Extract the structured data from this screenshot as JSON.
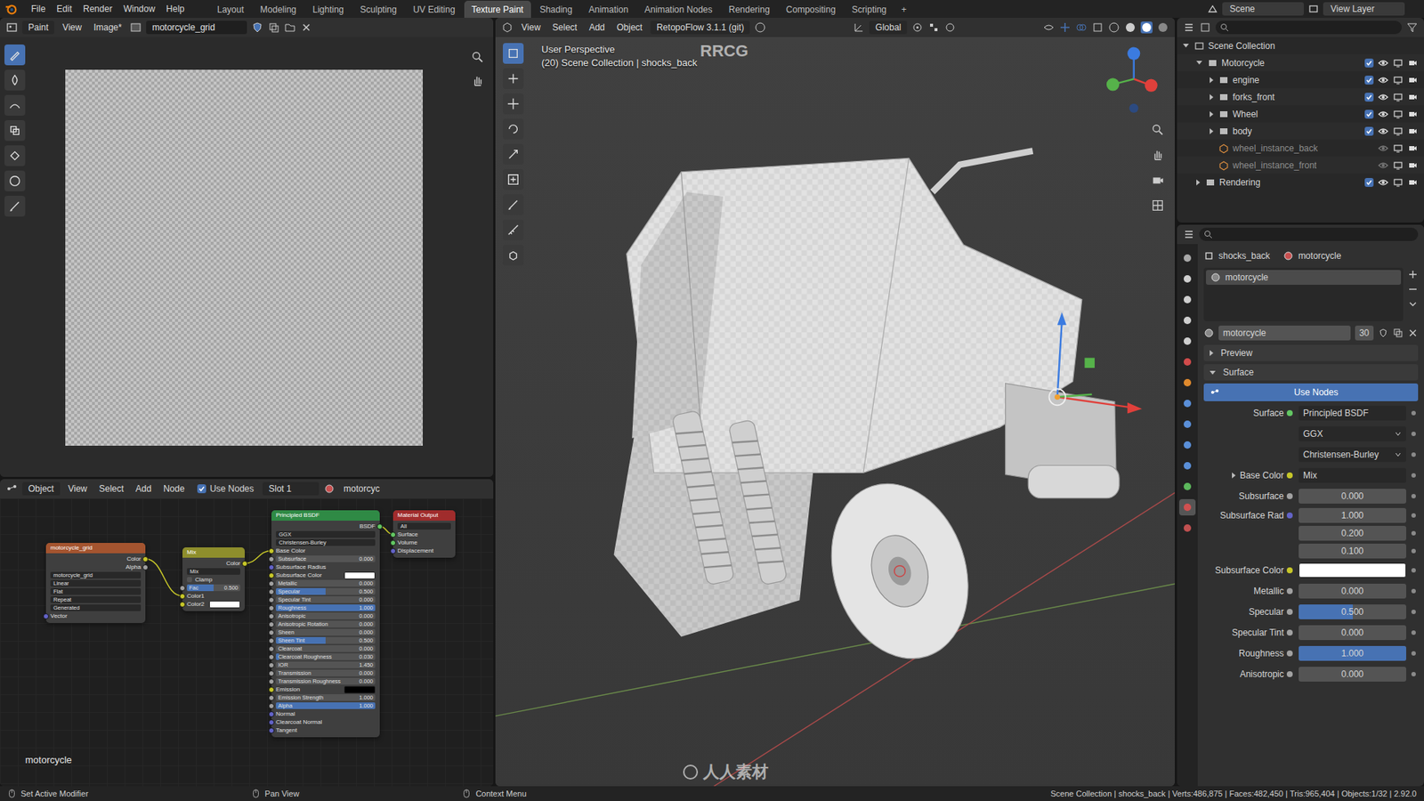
{
  "top_bar": {
    "menus": [
      "File",
      "Edit",
      "Render",
      "Window",
      "Help"
    ],
    "workspaces": [
      {
        "label": "Layout",
        "selected": false
      },
      {
        "label": "Modeling",
        "selected": false
      },
      {
        "label": "Lighting",
        "selected": false
      },
      {
        "label": "Sculpting",
        "selected": false
      },
      {
        "label": "UV Editing",
        "selected": false
      },
      {
        "label": "Texture Paint",
        "selected": true
      },
      {
        "label": "Shading",
        "selected": false
      },
      {
        "label": "Animation",
        "selected": false
      },
      {
        "label": "Animation Nodes",
        "selected": false
      },
      {
        "label": "Rendering",
        "selected": false
      },
      {
        "label": "Compositing",
        "selected": false
      },
      {
        "label": "Scripting",
        "selected": false
      }
    ],
    "add_workspace": "+",
    "scene": "Scene",
    "view_layer": "View Layer"
  },
  "watermarks": {
    "top": "RRCG",
    "bottom": "人人素材"
  },
  "image_editor": {
    "mode": "Paint",
    "menus": [
      "View",
      "Image*"
    ],
    "image_name": "motorcycle_grid",
    "tools": [
      {
        "kind": "draw",
        "selected": true
      },
      {
        "kind": "soften",
        "selected": false
      },
      {
        "kind": "smear",
        "selected": false
      },
      {
        "kind": "clone",
        "selected": false
      },
      {
        "kind": "fill",
        "selected": false
      },
      {
        "kind": "mask",
        "selected": false
      },
      {
        "kind": "annotate",
        "selected": false
      }
    ]
  },
  "node_editor": {
    "type": "Object",
    "menus": [
      "View",
      "Select",
      "Add",
      "Node"
    ],
    "use_nodes": {
      "label": "Use Nodes",
      "checked": true
    },
    "slot": "Slot 1",
    "material": "motorcyc",
    "tree_label": "motorcycle",
    "nodes": [
      {
        "title": "motorcycle_grid",
        "color": "#a4542f",
        "rows": [
          {
            "kind": "out",
            "label": "Color",
            "socket": "#c7c729"
          },
          {
            "kind": "out",
            "label": "Alpha",
            "socket": "#a1a1a1"
          },
          {
            "kind": "field",
            "label": "motorcycle_grid"
          },
          {
            "kind": "dropdown",
            "label": "Linear"
          },
          {
            "kind": "dropdown",
            "label": "Flat"
          },
          {
            "kind": "dropdown",
            "label": "Repeat"
          },
          {
            "kind": "dropdown",
            "label": "Generated"
          },
          {
            "kind": "in",
            "label": "Vector",
            "socket": "#6363c7"
          }
        ]
      },
      {
        "title": "Mix",
        "color": "#8e8e2c",
        "rows": [
          {
            "kind": "out",
            "label": "Color",
            "socket": "#c7c729"
          },
          {
            "kind": "dropdown",
            "label": "Mix"
          },
          {
            "kind": "check",
            "label": "Clamp",
            "checked": false
          },
          {
            "kind": "value",
            "label": "Fac",
            "value": "0.500",
            "level": 0.5,
            "socket": "#a1a1a1"
          },
          {
            "kind": "in",
            "label": "Color1",
            "socket": "#c7c729"
          },
          {
            "kind": "color",
            "label": "Color2",
            "swatch": "#ffffff",
            "socket": "#c7c729"
          }
        ]
      },
      {
        "title": "Principled BSDF",
        "color": "#2f8a45",
        "rows": [
          {
            "kind": "out",
            "label": "BSDF",
            "socket": "#63c763"
          },
          {
            "kind": "dropdown",
            "label": "GGX"
          },
          {
            "kind": "dropdown",
            "label": "Christensen-Burley"
          },
          {
            "kind": "in",
            "label": "Base Color",
            "socket": "#c7c729"
          },
          {
            "kind": "value",
            "label": "Subsurface",
            "value": "0.000",
            "level": 0,
            "socket": "#a1a1a1"
          },
          {
            "kind": "in",
            "label": "Subsurface Radius",
            "socket": "#6363c7"
          },
          {
            "kind": "color",
            "label": "Subsurface Color",
            "swatch": "#ffffff",
            "socket": "#c7c729"
          },
          {
            "kind": "value",
            "label": "Metallic",
            "value": "0.000",
            "level": 0,
            "socket": "#a1a1a1"
          },
          {
            "kind": "value",
            "label": "Specular",
            "value": "0.500",
            "level": 0.5,
            "socket": "#a1a1a1"
          },
          {
            "kind": "value",
            "label": "Specular Tint",
            "value": "0.000",
            "level": 0,
            "socket": "#a1a1a1"
          },
          {
            "kind": "value",
            "label": "Roughness",
            "value": "1.000",
            "level": 1,
            "socket": "#a1a1a1"
          },
          {
            "kind": "value",
            "label": "Anisotropic",
            "value": "0.000",
            "level": 0,
            "socket": "#a1a1a1"
          },
          {
            "kind": "value",
            "label": "Anisotropic Rotation",
            "value": "0.000",
            "level": 0,
            "socket": "#a1a1a1"
          },
          {
            "kind": "value",
            "label": "Sheen",
            "value": "0.000",
            "level": 0,
            "socket": "#a1a1a1"
          },
          {
            "kind": "value",
            "label": "Sheen Tint",
            "value": "0.500",
            "level": 0.5,
            "socket": "#a1a1a1"
          },
          {
            "kind": "value",
            "label": "Clearcoat",
            "value": "0.000",
            "level": 0,
            "socket": "#a1a1a1"
          },
          {
            "kind": "value",
            "label": "Clearcoat Roughness",
            "value": "0.030",
            "level": 0.03,
            "socket": "#a1a1a1"
          },
          {
            "kind": "value",
            "label": "IOR",
            "value": "1.450",
            "level": 0,
            "socket": "#a1a1a1"
          },
          {
            "kind": "value",
            "label": "Transmission",
            "value": "0.000",
            "level": 0,
            "socket": "#a1a1a1"
          },
          {
            "kind": "value",
            "label": "Transmission Roughness",
            "value": "0.000",
            "level": 0,
            "socket": "#a1a1a1"
          },
          {
            "kind": "color",
            "label": "Emission",
            "swatch": "#000000",
            "socket": "#c7c729"
          },
          {
            "kind": "value",
            "label": "Emission Strength",
            "value": "1.000",
            "level": 0,
            "socket": "#a1a1a1"
          },
          {
            "kind": "value",
            "label": "Alpha",
            "value": "1.000",
            "level": 1,
            "socket": "#a1a1a1"
          },
          {
            "kind": "in",
            "label": "Normal",
            "socket": "#6363c7"
          },
          {
            "kind": "in",
            "label": "Clearcoat Normal",
            "socket": "#6363c7"
          },
          {
            "kind": "in",
            "label": "Tangent",
            "socket": "#6363c7"
          }
        ]
      },
      {
        "title": "Material Output",
        "color": "#a02c2c",
        "rows": [
          {
            "kind": "dropdown",
            "label": "All"
          },
          {
            "kind": "in",
            "label": "Surface",
            "socket": "#63c763"
          },
          {
            "kind": "in",
            "label": "Volume",
            "socket": "#63c763"
          },
          {
            "kind": "in",
            "label": "Displacement",
            "socket": "#6363c7"
          }
        ]
      }
    ]
  },
  "viewport": {
    "menus": [
      "View",
      "Select",
      "Add",
      "Object"
    ],
    "addon": "RetopoFlow 3.1.1 (git)",
    "orientation": "Global",
    "overlay": [
      "User Perspective",
      "(20) Scene Collection | shocks_back"
    ],
    "tools": [
      {
        "kind": "select",
        "selected": true
      },
      {
        "kind": "cursor",
        "selected": false
      },
      {
        "kind": "move",
        "selected": false
      },
      {
        "kind": "rotate",
        "selected": false
      },
      {
        "kind": "scale",
        "selected": false
      },
      {
        "kind": "transform",
        "selected": false
      },
      {
        "kind": "annotate",
        "selected": false
      },
      {
        "kind": "measure",
        "selected": false
      },
      {
        "kind": "add",
        "selected": false
      }
    ]
  },
  "outliner": {
    "items": [
      {
        "name": "Scene Collection",
        "kind": "root",
        "depth": 0,
        "expanded": true,
        "dimmed": false
      },
      {
        "name": "Motorcycle",
        "kind": "collection",
        "depth": 1,
        "expanded": true,
        "checked": true,
        "dimmed": false
      },
      {
        "name": "engine",
        "kind": "collection",
        "depth": 2,
        "expanded": false,
        "checked": true,
        "dimmed": false
      },
      {
        "name": "forks_front",
        "kind": "collection",
        "depth": 2,
        "expanded": false,
        "checked": true,
        "dimmed": false
      },
      {
        "name": "Wheel",
        "kind": "collection",
        "depth": 2,
        "expanded": false,
        "checked": true,
        "dimmed": false
      },
      {
        "name": "body",
        "kind": "collection",
        "depth": 2,
        "expanded": false,
        "checked": true,
        "dimmed": false
      },
      {
        "name": "wheel_instance_back",
        "kind": "object",
        "depth": 2,
        "dimmed": true
      },
      {
        "name": "wheel_instance_front",
        "kind": "object",
        "depth": 2,
        "dimmed": true
      },
      {
        "name": "Rendering",
        "kind": "collection",
        "depth": 1,
        "expanded": false,
        "checked": true,
        "dimmed": false
      }
    ]
  },
  "properties": {
    "object": "shocks_back",
    "material": "motorcycle",
    "tabs": [
      {
        "kind": "tool",
        "selected": false
      },
      {
        "kind": "render",
        "selected": false
      },
      {
        "kind": "output",
        "selected": false
      },
      {
        "kind": "view_layer",
        "selected": false
      },
      {
        "kind": "scene",
        "selected": false
      },
      {
        "kind": "world",
        "selected": false
      },
      {
        "kind": "object",
        "selected": false
      },
      {
        "kind": "modifiers",
        "selected": false
      },
      {
        "kind": "particles",
        "selected": false
      },
      {
        "kind": "physics",
        "selected": false
      },
      {
        "kind": "constraints",
        "selected": false
      },
      {
        "kind": "data",
        "selected": false
      },
      {
        "kind": "material",
        "selected": true
      },
      {
        "kind": "texture",
        "selected": false
      }
    ],
    "slots": [
      {
        "name": "motorcycle",
        "selected": true
      }
    ],
    "material_field": "motorcycle",
    "users": "30",
    "panels": [
      {
        "label": "Preview",
        "expanded": false
      },
      {
        "label": "Surface",
        "expanded": true
      }
    ],
    "use_nodes": "Use Nodes",
    "surface": {
      "label": "Surface",
      "value": "Principled BSDF"
    },
    "dropdowns": [
      "GGX",
      "Christensen-Burley"
    ],
    "rows": [
      {
        "label": "Base Color",
        "kind": "link",
        "value": "Mix",
        "expandable": true
      },
      {
        "label": "Subsurface",
        "kind": "value",
        "value": "0.000",
        "level": 0
      },
      {
        "label": "Subsurface Rad",
        "kind": "vector",
        "values": [
          "1.000",
          "0.200",
          "0.100"
        ]
      },
      {
        "label": "Subsurface Color",
        "kind": "color",
        "swatch": "#ffffff"
      },
      {
        "label": "Metallic",
        "kind": "value",
        "value": "0.000",
        "level": 0
      },
      {
        "label": "Specular",
        "kind": "value",
        "value": "0.500",
        "level": 0.5
      },
      {
        "label": "Specular Tint",
        "kind": "value",
        "value": "0.000",
        "level": 0
      },
      {
        "label": "Roughness",
        "kind": "value",
        "value": "1.000",
        "level": 1
      },
      {
        "label": "Anisotropic",
        "kind": "value",
        "value": "0.000",
        "level": 0
      }
    ]
  },
  "status_bar": {
    "hints": [
      "Set Active Modifier",
      "Pan View",
      "Context Menu"
    ],
    "stats": "Scene Collection | shocks_back | Verts:486,875 | Faces:482,450 | Tris:965,404 | Objects:1/32 | 2.92.0"
  }
}
